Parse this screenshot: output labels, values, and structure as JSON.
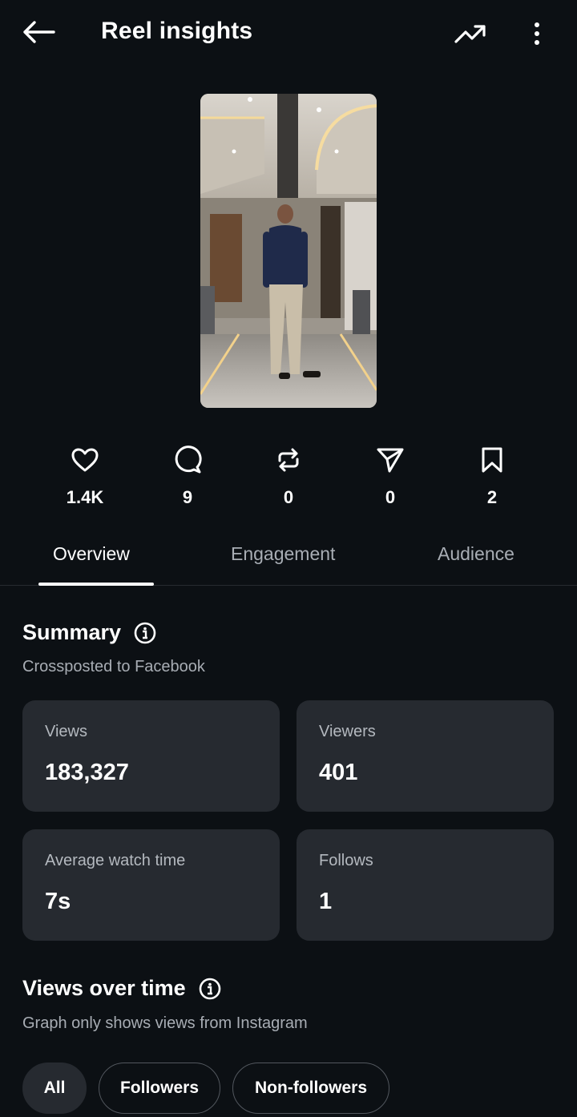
{
  "header": {
    "title": "Reel insights",
    "back_icon": "arrow-left-icon",
    "trend_icon": "trending-up-icon",
    "more_icon": "more-vertical-icon"
  },
  "stats": [
    {
      "icon": "heart-icon",
      "value": "1.4K"
    },
    {
      "icon": "comment-icon",
      "value": "9"
    },
    {
      "icon": "repost-icon",
      "value": "0"
    },
    {
      "icon": "share-icon",
      "value": "0"
    },
    {
      "icon": "bookmark-icon",
      "value": "2"
    }
  ],
  "tabs": [
    {
      "label": "Overview",
      "active": true
    },
    {
      "label": "Engagement",
      "active": false
    },
    {
      "label": "Audience",
      "active": false
    }
  ],
  "summary": {
    "title": "Summary",
    "subtitle": "Crossposted to Facebook",
    "cards": [
      {
        "label": "Views",
        "value": "183,327"
      },
      {
        "label": "Viewers",
        "value": "401"
      },
      {
        "label": "Average watch time",
        "value": "7s"
      },
      {
        "label": "Follows",
        "value": "1"
      }
    ]
  },
  "views_over_time": {
    "title": "Views over time",
    "subtitle": "Graph only shows views from Instagram",
    "filters": [
      {
        "label": "All",
        "active": true
      },
      {
        "label": "Followers",
        "active": false
      },
      {
        "label": "Non-followers",
        "active": false
      }
    ]
  },
  "colors": {
    "background": "#0c1014",
    "card": "#262a30",
    "muted_text": "#a8adb4",
    "text": "#ffffff"
  }
}
